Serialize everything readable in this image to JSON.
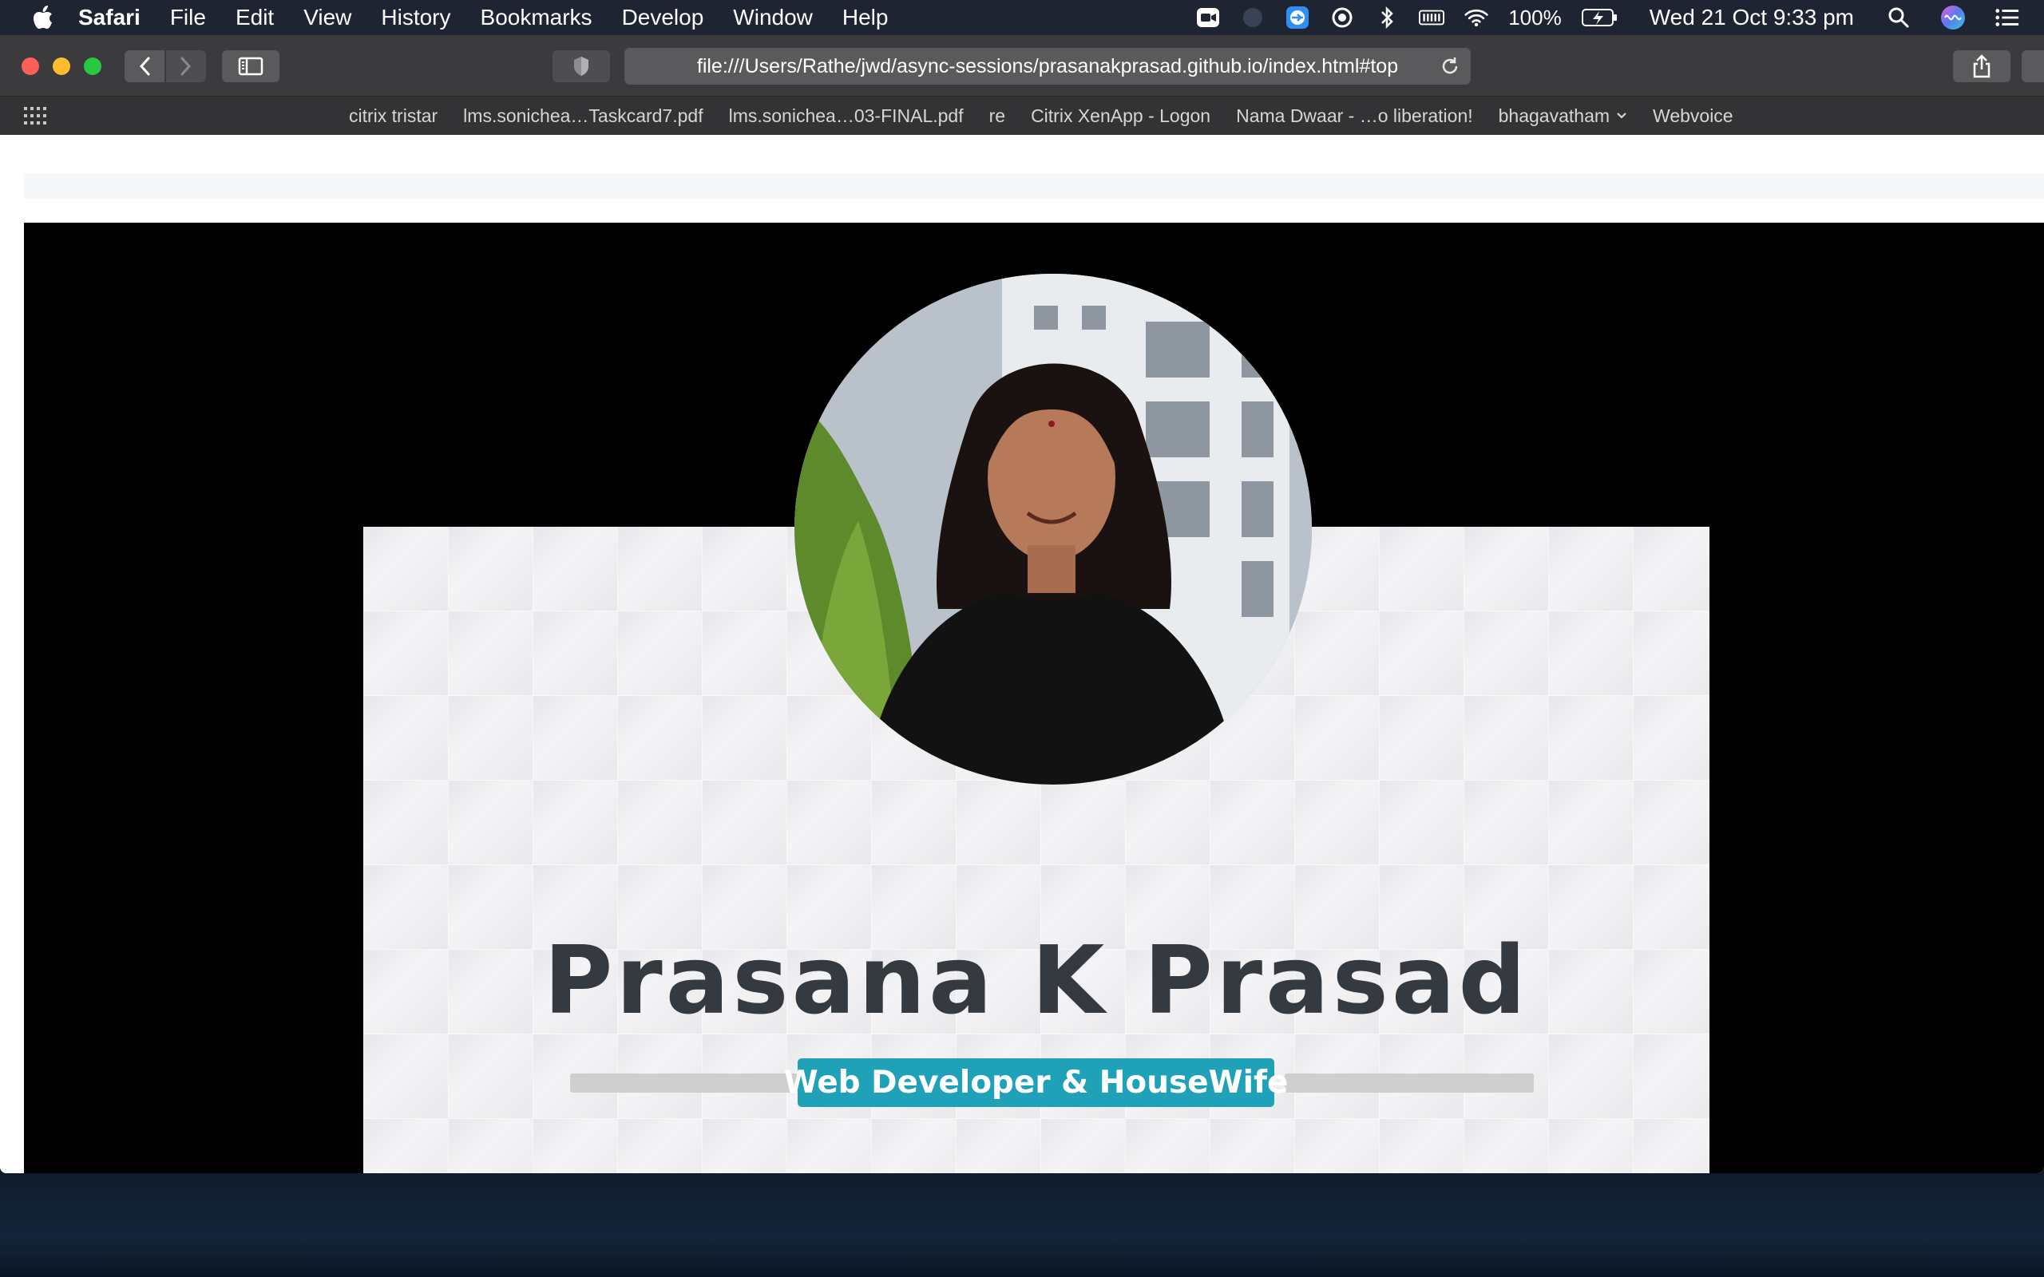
{
  "menubar": {
    "app_name": "Safari",
    "items": [
      "File",
      "Edit",
      "View",
      "History",
      "Bookmarks",
      "Develop",
      "Window",
      "Help"
    ],
    "battery": "100%",
    "datetime": "Wed 21 Oct  9:33 pm"
  },
  "browser": {
    "url": "file:///Users/Rathe/jwd/async-sessions/prasanakprasad.github.io/index.html#top",
    "favorites": [
      "citrix tristar",
      "lms.sonichea…Taskcard7.pdf",
      "lms.sonichea…03-FINAL.pdf",
      "re",
      "Citrix XenApp - Logon",
      "Nama Dwaar - …o liberation!",
      "bhagavatham",
      "Webvoice"
    ]
  },
  "page": {
    "name": "Prasana K Prasad",
    "role": "Web Developer & HouseWife"
  },
  "colors": {
    "badge": "#1fa2b8",
    "name_text": "#343a40",
    "hero_bg": "#000000"
  },
  "icons": {
    "features": [
      "star-circle-icon",
      "info-circle-icon",
      "id-card-icon"
    ]
  }
}
